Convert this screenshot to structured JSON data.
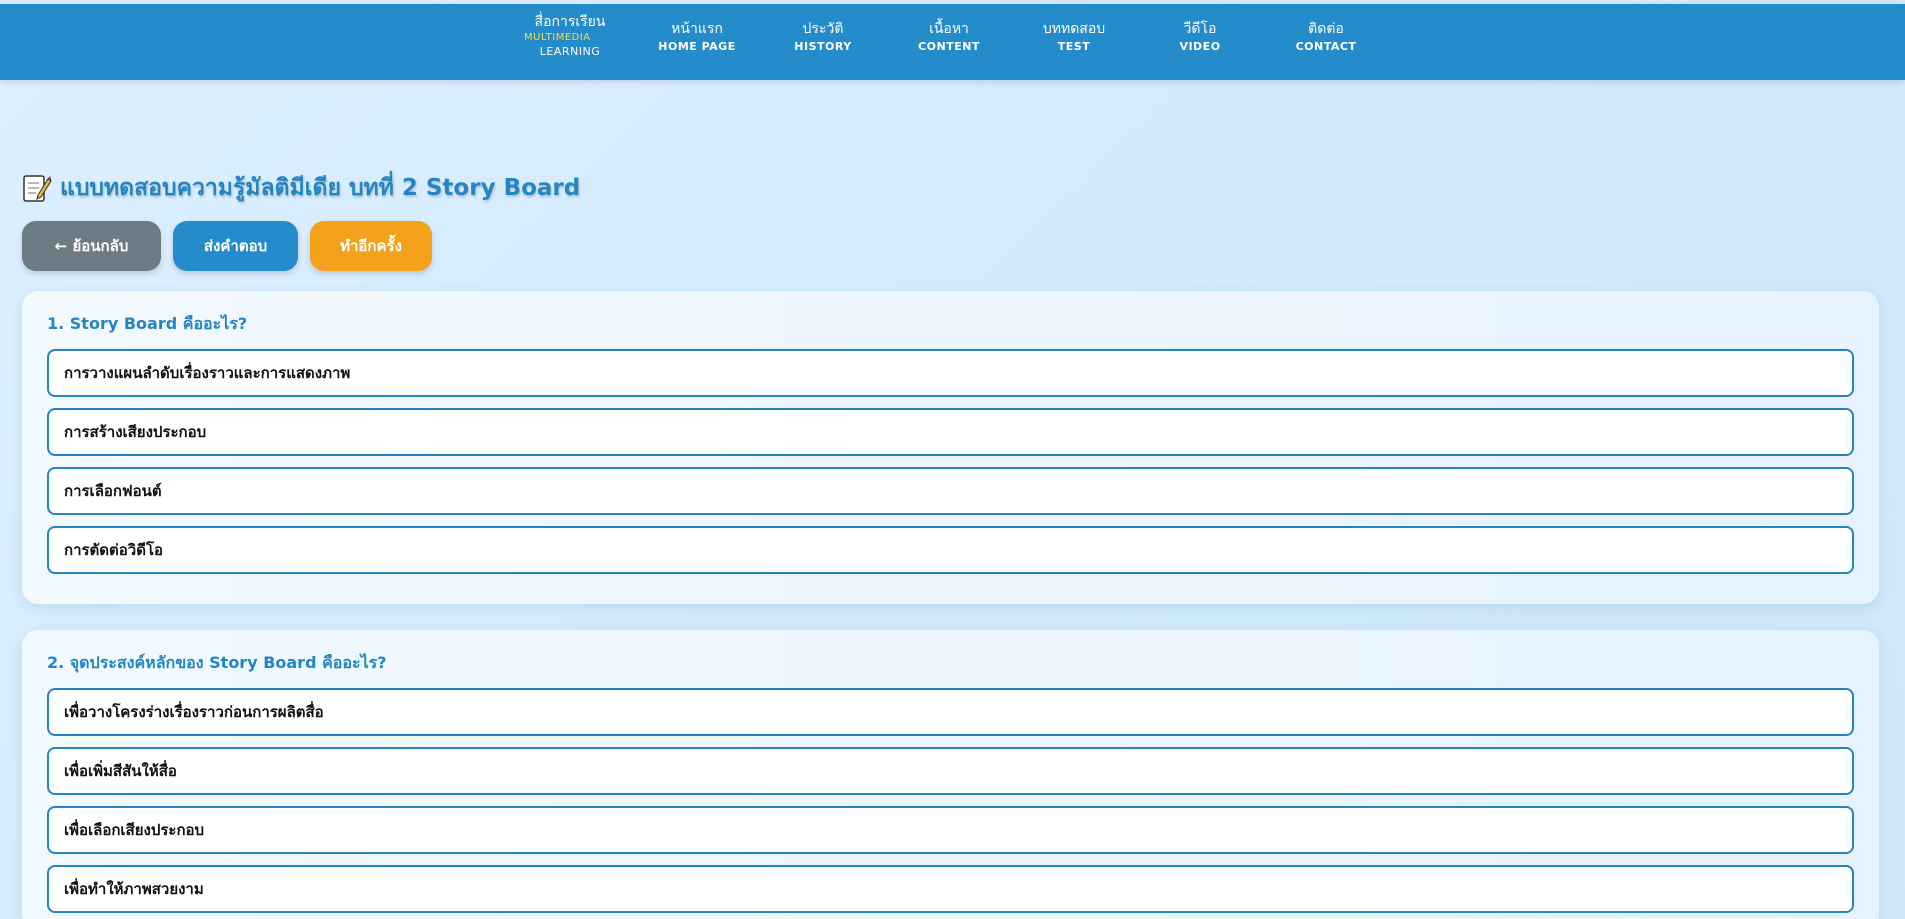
{
  "brand": {
    "line1": "สื่อการเรียน",
    "line2": "MULTIMEDIA",
    "line3": "LEARNING"
  },
  "nav": [
    {
      "th": "หน้าแรก",
      "en": "HOME PAGE"
    },
    {
      "th": "ประวัติ",
      "en": "HISTORY"
    },
    {
      "th": "เนื้อหา",
      "en": "CONTENT"
    },
    {
      "th": "บททดสอบ",
      "en": "TEST"
    },
    {
      "th": "วีดีโอ",
      "en": "VIDEO"
    },
    {
      "th": "ติดต่อ",
      "en": "CONTACT"
    }
  ],
  "page": {
    "title": "แบบทดสอบความรู้มัลติมีเดีย บทที่ 2 Story Board",
    "title_icon": "memo-icon"
  },
  "buttons": {
    "back": "← ย้อนกลับ",
    "submit": "ส่งคำตอบ",
    "retry": "ทำอีกครั้ง"
  },
  "colors": {
    "primary": "#258ccb",
    "accent": "#f4a11b",
    "secondary": "#6d7b85",
    "brand_highlight": "#ffd93b"
  },
  "questions": [
    {
      "text": "1. Story Board คืออะไร?",
      "options": [
        "การวางแผนลำดับเรื่องราวและการแสดงภาพ",
        "การสร้างเสียงประกอบ",
        "การเลือกฟอนต์",
        "การตัดต่อวิดีโอ"
      ]
    },
    {
      "text": "2. จุดประสงค์หลักของ Story Board คืออะไร?",
      "options": [
        "เพื่อวางโครงร่างเรื่องราวก่อนการผลิตสื่อ",
        "เพื่อเพิ่มสีสันให้สื่อ",
        "เพื่อเลือกเสียงประกอบ",
        "เพื่อทำให้ภาพสวยงาม"
      ]
    }
  ]
}
